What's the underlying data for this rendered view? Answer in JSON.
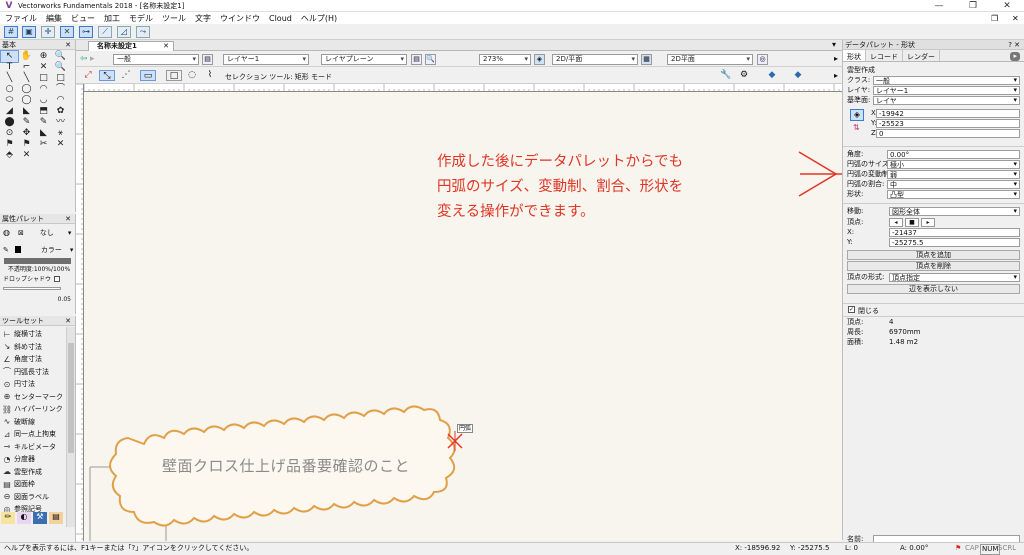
{
  "window": {
    "title": "Vectorworks Fundamentals 2018 - [名称未設定1]"
  },
  "menu": [
    "ファイル",
    "編集",
    "ビュー",
    "加工",
    "モデル",
    "ツール",
    "文字",
    "ウインドウ",
    "Cloud",
    "ヘルプ(H)"
  ],
  "left_palette": {
    "title": "基本",
    "tools": [
      "↖",
      "✋",
      "⊕",
      "🔍",
      "T",
      "⌐",
      "✕",
      "🔍",
      "╲",
      "╲",
      "□",
      "□",
      "○",
      "◯",
      "◠",
      "⌒",
      "⬭",
      "◯",
      "◡",
      "◠",
      "◢",
      "◣",
      "⬒",
      "✿",
      "⬤",
      "✎",
      "✎",
      "〰",
      "⊙",
      "✥",
      "◣",
      "⚹",
      "⚑",
      "⚑",
      "✂",
      "✕",
      "⬘",
      "✕",
      "",
      ""
    ]
  },
  "attr_palette": {
    "title": "属性パレット",
    "fill_label": "なし",
    "color_label": "カラー",
    "opacity": "不透明度:100%/100%",
    "shadow": "ドロップシャドウ",
    "line_weight": "0.05"
  },
  "toolset": {
    "title": "ツールセット",
    "items": [
      "縦横寸法",
      "斜め寸法",
      "角度寸法",
      "円弧長寸法",
      "円寸法",
      "センターマーク",
      "ハイパーリンク",
      "破断線",
      "同一点上拘束",
      "キルビメータ",
      "分度器",
      "雲型作成",
      "図面枠",
      "図面ラベル",
      "参照記号"
    ]
  },
  "document_tab": "名称未設定1",
  "viewbar": {
    "class": "一般",
    "layer": "レイヤー1",
    "layer_plane": "レイヤプレーン",
    "zoom": "273%",
    "view": "2D/平面",
    "render": "2D平面"
  },
  "mode_label": "セレクション ツール: 矩形 モード",
  "ruler_ticks": [
    "3000",
    "2500",
    "2000",
    "1500",
    "1000",
    "500",
    "0",
    "5000",
    "1000",
    "2000",
    "1500",
    "2500",
    "3000",
    "2500",
    "3000",
    "3500",
    "4000",
    "4500",
    "5000",
    "2000"
  ],
  "right_palette": {
    "title": "データパレット - 形状",
    "tabs": [
      "形状",
      "レコード",
      "レンダー"
    ],
    "section": "雲型作成",
    "fields": [
      {
        "label": "クラス:",
        "value": "一般"
      },
      {
        "label": "レイヤ:",
        "value": "レイヤー1"
      },
      {
        "label": "基準面:",
        "value": "レイヤ"
      }
    ],
    "coords": [
      {
        "label": "X:",
        "value": "-19942"
      },
      {
        "label": "Y:",
        "value": "-25523"
      },
      {
        "label": "Z:",
        "value": "0"
      }
    ],
    "arc_fields": [
      {
        "label": "角度:",
        "value": "0.00°"
      },
      {
        "label": "円弧のサイズ:",
        "value": "極小"
      },
      {
        "label": "円弧の変動制:",
        "value": "弱"
      },
      {
        "label": "円弧の割合:",
        "value": "中"
      },
      {
        "label": "形状:",
        "value": "凸型"
      }
    ],
    "move_label": "移動:",
    "move_value": "図形全体",
    "vertex_label": "頂点:",
    "vx_label": "X:",
    "vx": "-21437",
    "vy_label": "Y:",
    "vy": "-25275.5",
    "btn_add": "頂点を追加",
    "btn_del": "頂点を削除",
    "vtype_label": "頂点の形式:",
    "vtype": "頂点指定",
    "btn_edges": "辺を表示しない",
    "closed_label": "閉じる",
    "info": [
      {
        "label": "頂点:",
        "value": "4"
      },
      {
        "label": "周長:",
        "value": "6970mm"
      },
      {
        "label": "面積:",
        "value": "1.48 m2"
      }
    ],
    "name_label": "名前:"
  },
  "annotation_lines": [
    "作成した後にデータパレットからでも",
    "円弧のサイズ、変動制、割合、形状を",
    "変える操作ができます。"
  ],
  "cloud_text": "壁面クロス仕上げ品番要確認のこと",
  "snap_tag": "円弧",
  "status": {
    "help": "ヘルプを表示するには、F1キーまたは「?」アイコンをクリックしてください。",
    "x": "X: -18596.92",
    "y": "Y: -25275.5",
    "l": "L: 0",
    "a": "A: 0.00°",
    "cap": "CAP",
    "num": "NUM",
    "scrl": "SCRL"
  },
  "colors": {
    "annotation": "#e03626",
    "cloud": "#e0a04a"
  }
}
